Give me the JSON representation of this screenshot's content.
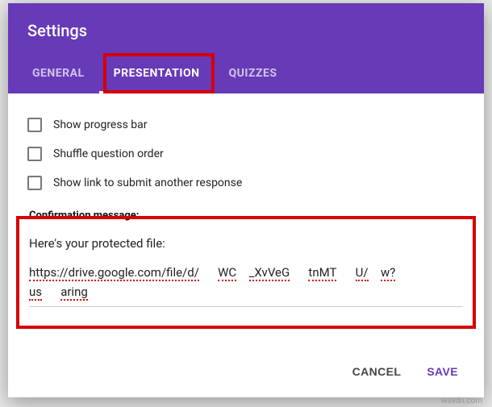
{
  "colors": {
    "accent": "#673ab7",
    "highlight": "#d60000"
  },
  "header": {
    "title": "Settings"
  },
  "tabs": {
    "general": "GENERAL",
    "presentation": "PRESENTATION",
    "quizzes": "QUIZZES",
    "active": "presentation"
  },
  "options": {
    "show_progress": {
      "label": "Show progress bar",
      "checked": false
    },
    "shuffle": {
      "label": "Shuffle question order",
      "checked": false
    },
    "show_link": {
      "label": "Show link to submit another response",
      "checked": false
    }
  },
  "confirmation": {
    "label": "Confirmation message:",
    "line1": "Here's your protected file:",
    "url_fragments": [
      "https://drive.google.com/file/d/",
      "WC",
      "_XvVeG",
      "tnMT",
      "U/",
      "w?",
      "us",
      "aring"
    ]
  },
  "actions": {
    "cancel": "CANCEL",
    "save": "SAVE"
  },
  "watermark": "wsxdn.com"
}
